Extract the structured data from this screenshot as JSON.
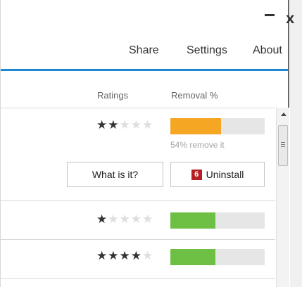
{
  "window": {
    "minimize_icon": "minimize-icon",
    "close_label": "X"
  },
  "nav": {
    "share": "Share",
    "settings": "Settings",
    "about": "About"
  },
  "columns": {
    "ratings": "Ratings",
    "removal": "Removal %"
  },
  "rows": [
    {
      "rating": 2,
      "max_rating": 5,
      "removal_fraction": 0.54,
      "bar_color": "#f5a623",
      "note": "54% remove it"
    },
    {
      "rating": 1,
      "max_rating": 5,
      "removal_fraction": 0.48,
      "bar_color": "#6ec045"
    },
    {
      "rating": 4,
      "max_rating": 5,
      "removal_fraction": 0.48,
      "bar_color": "#6ec045"
    }
  ],
  "actions": {
    "what_is_it": "What is it?",
    "uninstall_badge": "6",
    "uninstall": "Uninstall"
  },
  "colors": {
    "accent": "#1d88d6",
    "badge": "#b52025"
  }
}
